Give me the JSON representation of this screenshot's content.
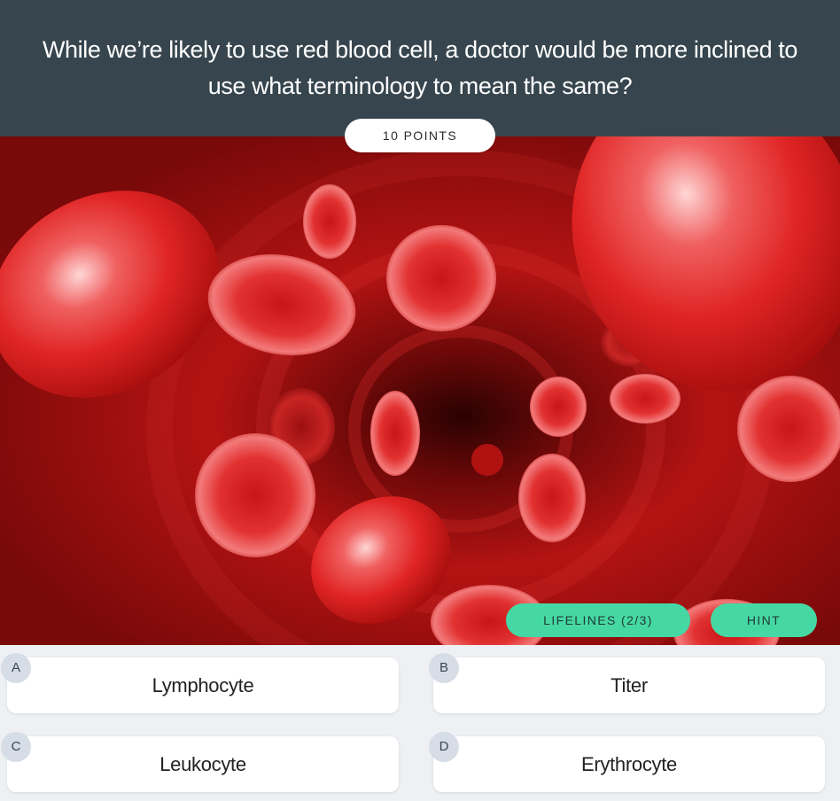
{
  "question": {
    "text": "While we’re likely to use red blood cell, a doctor would be more inclined to use what terminology to mean the same?",
    "points_label": "10 POINTS"
  },
  "image": {
    "icon": "red-blood-cells-illustration",
    "colors": {
      "primary": "#c81818",
      "dark": "#3a0303",
      "highlight": "#ffe2e2"
    }
  },
  "actions": {
    "lifelines_label": "LIFELINES (2/3)",
    "hint_label": "HINT",
    "accent": "#46d8a4"
  },
  "answers": [
    {
      "letter": "A",
      "text": "Lymphocyte"
    },
    {
      "letter": "B",
      "text": "Titer"
    },
    {
      "letter": "C",
      "text": "Leukocyte"
    },
    {
      "letter": "D",
      "text": "Erythrocyte"
    }
  ],
  "theme": {
    "header_bg": "#37464e",
    "page_bg": "#eef0f3",
    "badge_bg": "#d6dde6"
  }
}
